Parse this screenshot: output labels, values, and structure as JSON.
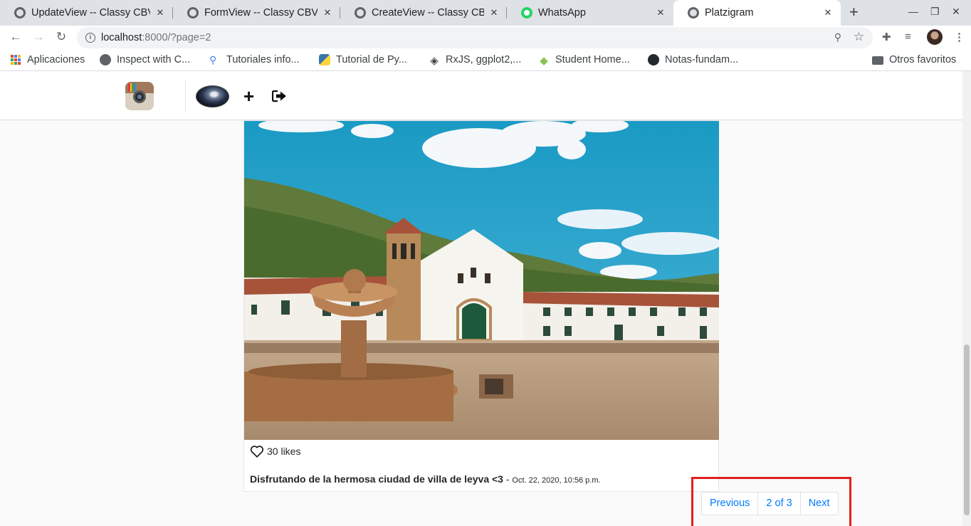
{
  "browser": {
    "tabs": [
      {
        "title": "UpdateView -- Classy CBV",
        "favicon": "globe-icon",
        "active": false
      },
      {
        "title": "FormView -- Classy CBV",
        "favicon": "globe-icon",
        "active": false
      },
      {
        "title": "CreateView -- Classy CBV",
        "favicon": "globe-icon",
        "active": false
      },
      {
        "title": "WhatsApp",
        "favicon": "whatsapp-icon",
        "active": false
      },
      {
        "title": "Platzigram",
        "favicon": "globe-icon",
        "active": true
      }
    ],
    "address": {
      "host": "localhost",
      "path": ":8000/?page=2"
    },
    "bookmarks": [
      {
        "label": "Aplicaciones",
        "icon": "apps-icon"
      },
      {
        "label": "Inspect with C...",
        "icon": "globe-icon"
      },
      {
        "label": "Tutoriales info...",
        "icon": "bulb-icon"
      },
      {
        "label": "Tutorial de Py...",
        "icon": "python-icon"
      },
      {
        "label": "RxJS, ggplot2,...",
        "icon": "diamond-icon"
      },
      {
        "label": "Student Home...",
        "icon": "leaf-icon"
      },
      {
        "label": "Notas-fundam...",
        "icon": "github-icon"
      }
    ],
    "other_bookmarks": "Otros favoritos"
  },
  "nav": {
    "logo_icon": "instagram-logo-icon",
    "add_icon": "plus-icon",
    "logout_icon": "logout-icon"
  },
  "post": {
    "likes": "30 likes",
    "caption": "Disfrutando de la hermosa ciudad de villa de leyva <3",
    "separator": " - ",
    "date": "Oct. 22, 2020, 10:56 p.m."
  },
  "pagination": {
    "previous": "Previous",
    "current": "2 of 3",
    "next": "Next"
  },
  "colors": {
    "link": "#007bff",
    "highlight": "#e0201d"
  }
}
